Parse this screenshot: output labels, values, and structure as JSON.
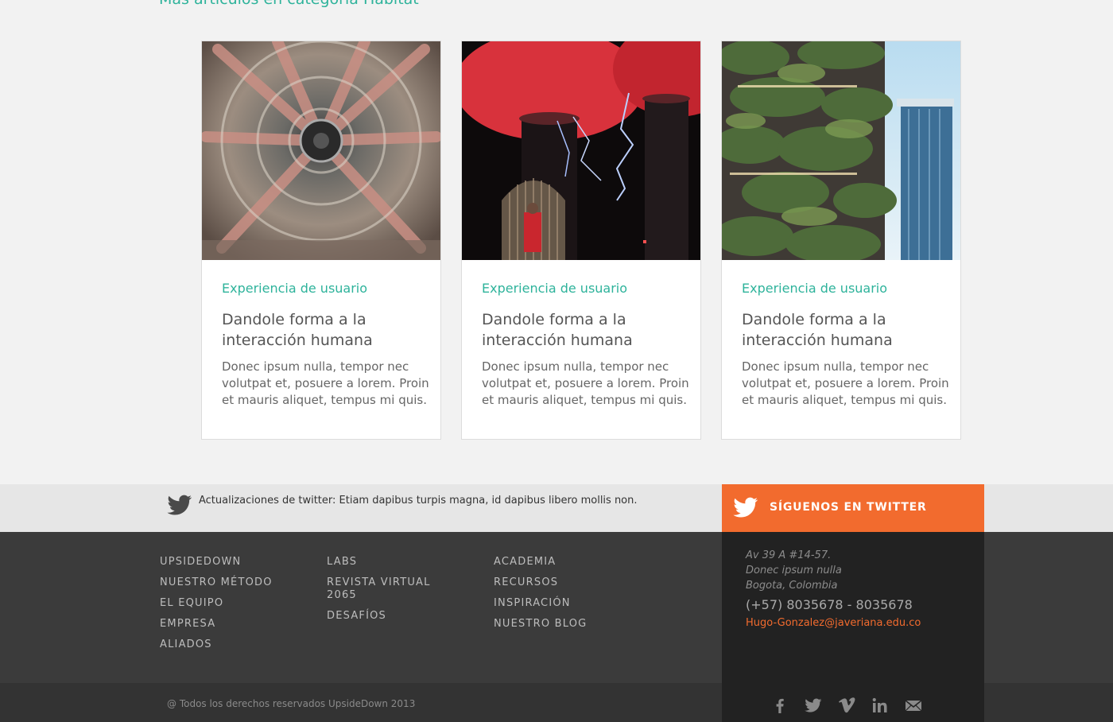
{
  "section": {
    "heading": "Más artículos en categoría Hábitat"
  },
  "cards": [
    {
      "image_icon": "particle-accelerator-photo",
      "category": "Experiencia de usuario",
      "title": "Dandole forma a la interacción humana",
      "excerpt": "Donec ipsum nulla, tempor nec volutpat et, posuere a lorem. Proin et mauris aliquet, tempus mi quis."
    },
    {
      "image_icon": "tesla-coil-photo",
      "category": "Experiencia de usuario",
      "title": "Dandole forma a la interacción humana",
      "excerpt": "Donec ipsum nulla, tempor nec volutpat et, posuere a lorem. Proin et mauris aliquet, tempus mi quis."
    },
    {
      "image_icon": "vertical-forest-building-photo",
      "category": "Experiencia de usuario",
      "title": "Dandole forma a la interacción humana",
      "excerpt": "Donec ipsum nulla, tempor nec volutpat et, posuere a lorem. Proin et mauris aliquet, tempus mi quis."
    }
  ],
  "twitter": {
    "update_text": "Actualizaciones de twitter: Etiam dapibus turpis magna, id dapibus libero mollis non.",
    "follow_label": "SÍGUENOS EN TWITTER",
    "follow_bg": "#f26b2e"
  },
  "footer_nav": {
    "col1": [
      "UPSIDEDOWN",
      "NUESTRO MÉTODO",
      "EL EQUIPO",
      "EMPRESA",
      "ALIADOS"
    ],
    "col2": [
      "LABS",
      "REVISTA VIRTUAL 2065",
      "DESAFÍOS"
    ],
    "col3": [
      "ACADEMIA",
      "RECURSOS",
      "INSPIRACIÓN",
      "NUESTRO BLOG"
    ]
  },
  "contact": {
    "address_line1": "Av 39 A #14-57.",
    "address_line2": "Donec ipsum nulla",
    "address_line3": "Bogota, Colombia",
    "phone": "(+57) 8035678 - 8035678",
    "email": "Hugo-Gonzalez@javeriana.edu.co"
  },
  "copyright": "@ Todos los derechos reservados UpsideDown 2013",
  "social": [
    "facebook-icon",
    "twitter-icon",
    "vimeo-icon",
    "linkedin-icon",
    "mail-icon"
  ],
  "colors": {
    "accent_teal": "#2eb39b",
    "accent_orange": "#f26b2e"
  }
}
